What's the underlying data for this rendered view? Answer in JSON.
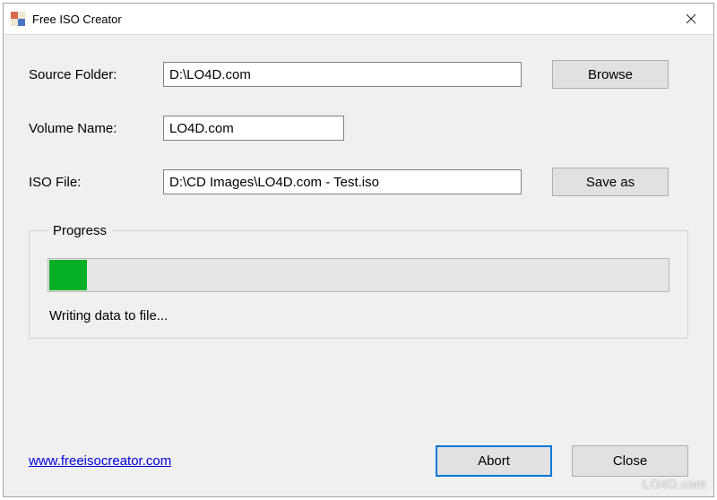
{
  "window": {
    "title": "Free ISO Creator"
  },
  "form": {
    "source_label": "Source Folder:",
    "source_value": "D:\\LO4D.com",
    "browse_label": "Browse",
    "volume_label": "Volume Name:",
    "volume_value": "LO4D.com",
    "iso_label": "ISO File:",
    "iso_value": "D:\\CD Images\\LO4D.com - Test.iso",
    "saveas_label": "Save as"
  },
  "progress": {
    "group_title": "Progress",
    "percent": 6,
    "status": "Writing data to file..."
  },
  "footer": {
    "link_text": "www.freeisocreator.com",
    "abort_label": "Abort",
    "close_label": "Close"
  },
  "watermark": "LO4D.com",
  "colors": {
    "progress_fill": "#06b025",
    "accent": "#0078d7"
  },
  "icons": {
    "app": "windows-form-icon",
    "close": "close-icon"
  }
}
